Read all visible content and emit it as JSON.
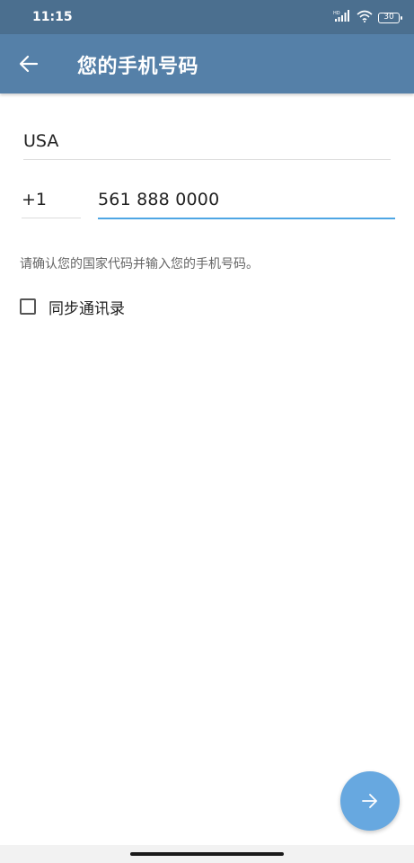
{
  "status_bar": {
    "time": "11:15",
    "battery": "30",
    "icons": [
      "hd-signal-icon",
      "wifi-icon",
      "battery-icon"
    ]
  },
  "app_bar": {
    "back_icon": "arrow-left-icon",
    "title": "您的手机号码"
  },
  "form": {
    "country": "USA",
    "country_code": "+1",
    "phone_number": "561 888 0000",
    "hint": "请确认您的国家代码并输入您的手机号码。",
    "sync_contacts_label": "同步通讯录",
    "sync_contacts_checked": false
  },
  "fab": {
    "icon": "arrow-right-icon"
  },
  "colors": {
    "status_bar": "#4b6f8f",
    "app_bar": "#5580a8",
    "accent": "#4ea6e4",
    "fab": "#67a8e0"
  }
}
